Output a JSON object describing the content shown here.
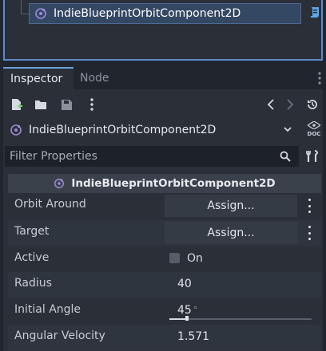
{
  "scene_tree": {
    "node": {
      "label": "IndieBlueprintOrbitComponent2D",
      "icon": "orbit-component-icon"
    },
    "script_icon": "script-icon"
  },
  "tabs": [
    {
      "label": "Inspector",
      "active": true
    },
    {
      "label": "Node",
      "active": false
    }
  ],
  "toolbar": {
    "icons": [
      "new-resource-icon",
      "open-folder-icon",
      "save-icon",
      "kebab-menu-icon",
      "history-back-icon",
      "history-forward-icon",
      "object-history-icon"
    ]
  },
  "object_selector": {
    "label": "IndieBlueprintOrbitComponent2D",
    "doc_label": "DOC"
  },
  "filter": {
    "placeholder": "Filter Properties"
  },
  "section": {
    "label": "IndieBlueprintOrbitComponent2D"
  },
  "properties": [
    {
      "name": "Orbit Around",
      "type": "assign",
      "value": "Assign..."
    },
    {
      "name": "Target",
      "type": "assign",
      "value": "Assign..."
    },
    {
      "name": "Active",
      "type": "checkbox",
      "value": "On",
      "checked": false
    },
    {
      "name": "Radius",
      "type": "number",
      "value": "40"
    },
    {
      "name": "Initial Angle",
      "type": "slider",
      "value": "45",
      "unit": "°",
      "fraction": 0.125
    },
    {
      "name": "Angular Velocity",
      "type": "number",
      "value": "1.571"
    }
  ],
  "colors": {
    "accent": "#6a9fd8",
    "orbit_icon": "#9f8bd8",
    "script_icon": "#5aa6e8"
  }
}
